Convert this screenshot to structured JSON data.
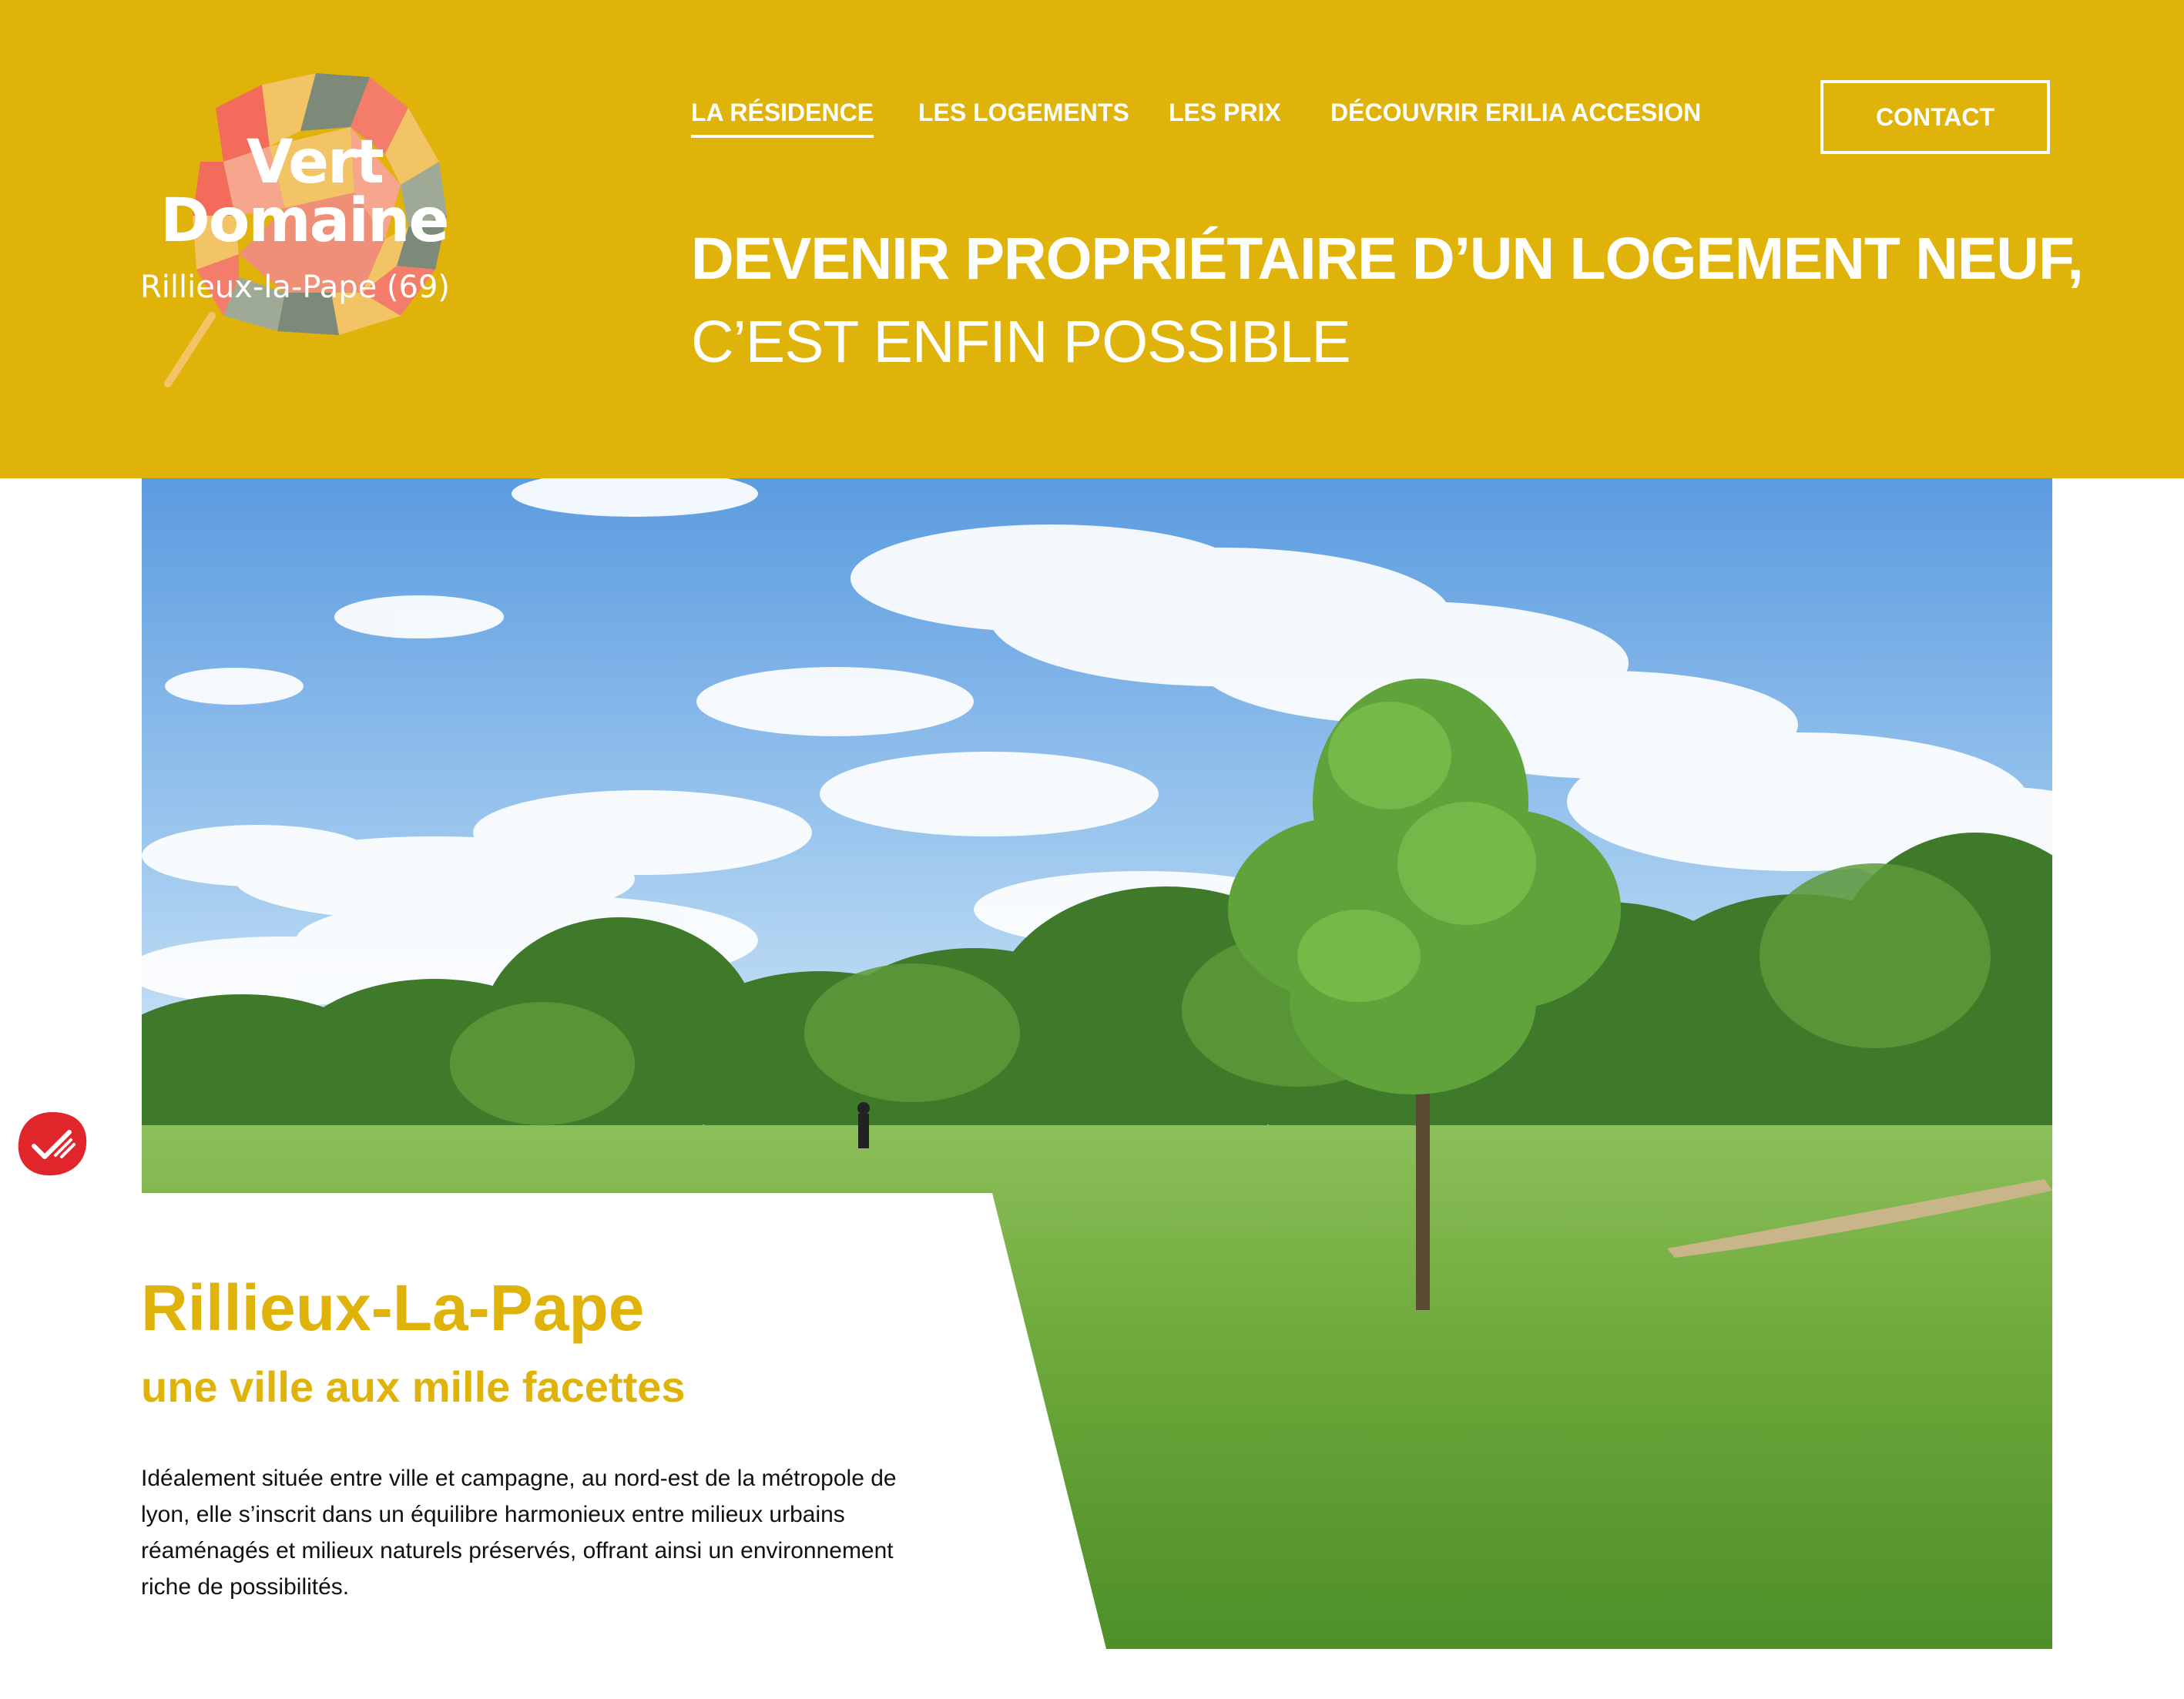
{
  "brand": {
    "logo_line1": "Vert",
    "logo_line2": "Domaine",
    "logo_location": "Rillieux-la-Pape (69)"
  },
  "nav": {
    "items": [
      {
        "label": "LA RÉSIDENCE",
        "active": true
      },
      {
        "label": "LES LOGEMENTS",
        "active": false
      },
      {
        "label": "LES PRIX",
        "active": false
      },
      {
        "label": "DÉCOUVRIR ERILIA ACCESION",
        "active": false
      }
    ],
    "contact_label": "CONTACT"
  },
  "hero": {
    "headline": "DEVENIR PROPRIÉTAIRE D’UN LOGEMENT NEUF,",
    "subheadline": "C’EST ENFIN POSSIBLE"
  },
  "intro": {
    "title": "Rillieux-La-Pape",
    "subtitle": "une ville aux mille facettes",
    "body": "Idéalement située entre ville et campagne, au nord-est de la métropole de lyon, elle s’inscrit dans un équilibre harmonieux entre milieux urbains réaménagés et milieux naturels préservés, offrant ainsi un environnement riche de possibilités."
  },
  "colors": {
    "brand_yellow": "#DFB30A",
    "white": "#FFFFFF",
    "text_dark": "#111111",
    "badge_red": "#E0252B"
  },
  "icons": {
    "logo": "leaf-mosaic-logo",
    "badge": "checkmark-badge-icon"
  }
}
